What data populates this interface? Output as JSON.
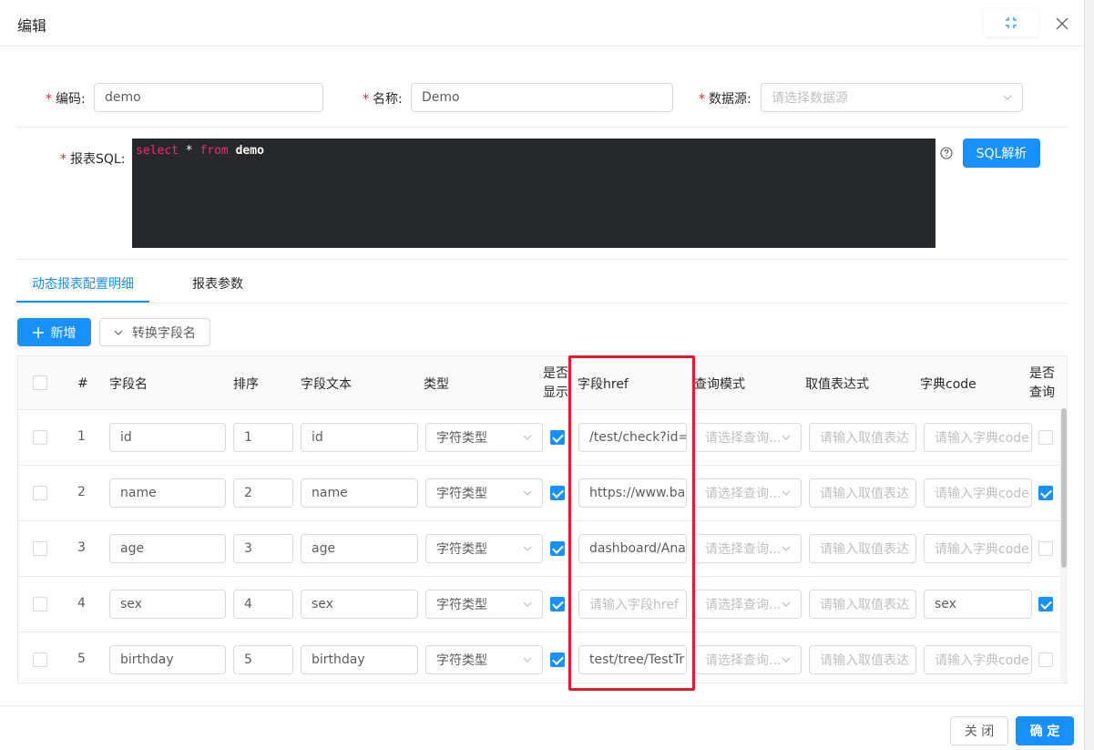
{
  "modal": {
    "title": "编辑",
    "expand_icon": "fullscreen-icon",
    "close_icon": "close-icon"
  },
  "form": {
    "code": {
      "label": "编码:",
      "value": "demo"
    },
    "name": {
      "label": "名称:",
      "value": "Demo"
    },
    "datasource": {
      "label": "数据源:",
      "placeholder": "请选择数据源"
    },
    "sql": {
      "label": "报表SQL:",
      "keyword1": "select",
      "star": " * ",
      "keyword2": "from",
      "table": " demo"
    },
    "help_icon": "question-circle-icon",
    "sql_parse_button": "SQL解析"
  },
  "tabs": [
    {
      "label": "动态报表配置明细",
      "active": true
    },
    {
      "label": "报表参数",
      "active": false
    }
  ],
  "toolbar": {
    "add_button": "新增",
    "convert_button": "转换字段名"
  },
  "table": {
    "headers": {
      "num": "#",
      "field_name": "字段名",
      "order": "排序",
      "field_text": "字段文本",
      "type": "类型",
      "show_line1": "是否",
      "show_line2": "显示",
      "href": "字段href",
      "query_mode": "查询模式",
      "expr": "取值表达式",
      "dict_code": "字典code",
      "query_line1": "是否",
      "query_line2": "查询"
    },
    "rows": [
      {
        "num": "1",
        "field_name": "id",
        "order": "1",
        "field_text": "id",
        "type": "字符类型",
        "show": true,
        "href": "/test/check?id=",
        "href_ph": false,
        "query_mode": "请选择查询...",
        "expr": "请输入取值表达",
        "dict_code": "请输入字典code",
        "dict_ph": true,
        "query": false
      },
      {
        "num": "2",
        "field_name": "name",
        "order": "2",
        "field_text": "name",
        "type": "字符类型",
        "show": true,
        "href": "https://www.ba",
        "href_ph": false,
        "query_mode": "请选择查询...",
        "expr": "请输入取值表达",
        "dict_code": "请输入字典code",
        "dict_ph": true,
        "query": true
      },
      {
        "num": "3",
        "field_name": "age",
        "order": "3",
        "field_text": "age",
        "type": "字符类型",
        "show": true,
        "href": "dashboard/Ana",
        "href_ph": false,
        "query_mode": "请选择查询...",
        "expr": "请输入取值表达",
        "dict_code": "请输入字典code",
        "dict_ph": true,
        "query": false
      },
      {
        "num": "4",
        "field_name": "sex",
        "order": "4",
        "field_text": "sex",
        "type": "字符类型",
        "show": true,
        "href": "请输入字段href",
        "href_ph": true,
        "query_mode": "请选择查询...",
        "expr": "请输入取值表达",
        "dict_code": "sex",
        "dict_ph": false,
        "query": true
      },
      {
        "num": "5",
        "field_name": "birthday",
        "order": "5",
        "field_text": "birthday",
        "type": "字符类型",
        "show": true,
        "href": "test/tree/TestTr",
        "href_ph": false,
        "query_mode": "请选择查询...",
        "expr": "请输入取值表达",
        "dict_code": "请输入字典code",
        "dict_ph": true,
        "query": false
      }
    ]
  },
  "footer": {
    "close_button": "关 闭",
    "ok_button": "确 定"
  },
  "colors": {
    "primary": "#1890ff",
    "required": "#f5222d",
    "highlight": "#e8192c",
    "editor_bg": "#27282c"
  }
}
